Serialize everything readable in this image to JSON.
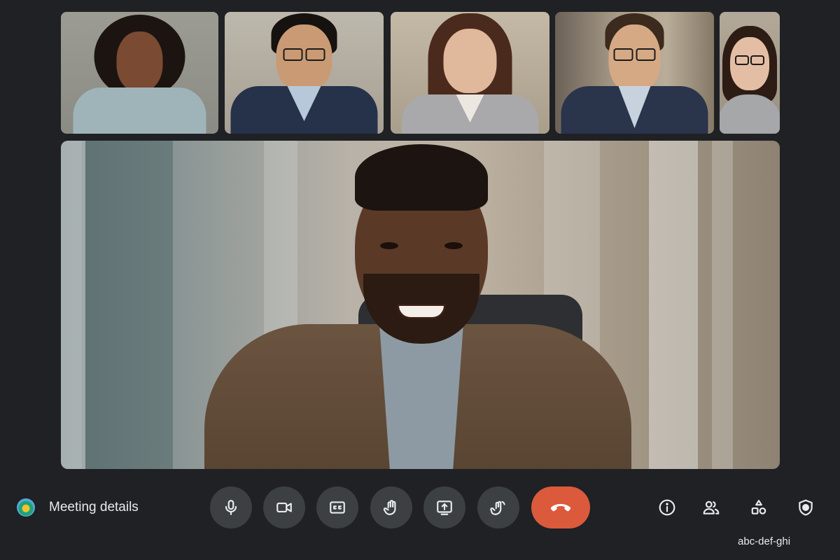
{
  "meeting": {
    "details_label": "Meeting details",
    "code": "abc-def-ghi"
  },
  "participants": {
    "thumbnails": [
      {
        "name": "participant-1",
        "skin": "#7a4a33",
        "hair": "#1c1410",
        "top": "#9fb4b8",
        "bg": "#8e9189"
      },
      {
        "name": "participant-2",
        "skin": "#c99a74",
        "hair": "#15120f",
        "top": "#26324a",
        "bg": "#b3aea3"
      },
      {
        "name": "participant-3",
        "skin": "#e0b89b",
        "hair": "#4a2a1c",
        "top": "#a9a9ab",
        "bg": "#b6ad9c"
      },
      {
        "name": "participant-4",
        "skin": "#d6a985",
        "hair": "#3b2a1d",
        "top": "#2a344b",
        "bg": "#9a8f7e"
      },
      {
        "name": "participant-5",
        "skin": "#e4bea4",
        "hair": "#2d1c14",
        "top": "#a5a7a8",
        "bg": "#a89f92"
      }
    ],
    "speaker": {
      "name": "active-speaker"
    }
  },
  "controls": [
    {
      "name": "microphone-button",
      "icon": "microphone-icon"
    },
    {
      "name": "camera-button",
      "icon": "camera-icon"
    },
    {
      "name": "captions-button",
      "icon": "captions-icon"
    },
    {
      "name": "raise-hand-button",
      "icon": "hand-icon"
    },
    {
      "name": "present-button",
      "icon": "present-icon"
    },
    {
      "name": "reactions-button",
      "icon": "reaction-hand-icon"
    },
    {
      "name": "leave-call-button",
      "icon": "phone-hangup-icon"
    }
  ],
  "right_actions": [
    {
      "name": "meeting-info-button",
      "icon": "info-icon"
    },
    {
      "name": "people-button",
      "icon": "people-icon"
    },
    {
      "name": "activities-button",
      "icon": "shapes-icon"
    },
    {
      "name": "host-controls-button",
      "icon": "shield-icon"
    }
  ],
  "colors": {
    "background": "#1f2124",
    "control_bg": "#3c4043",
    "end_call": "#db5a3c",
    "text": "#e8eaed"
  }
}
